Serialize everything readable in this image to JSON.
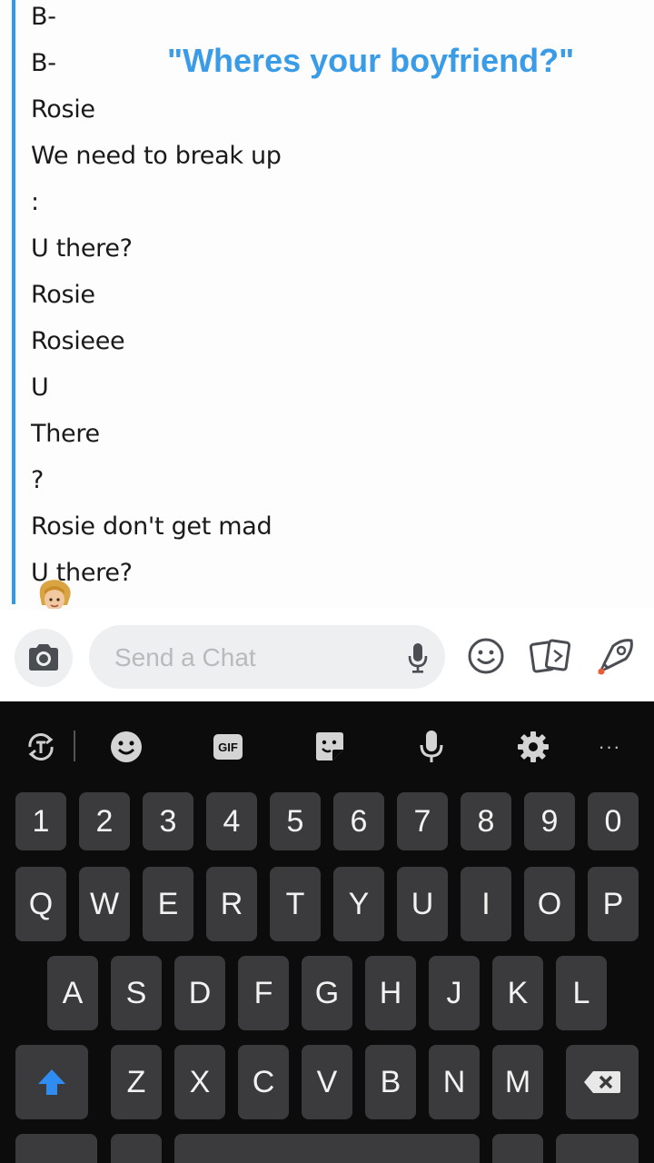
{
  "overlay_caption": "\"Wheres your boyfriend?\"",
  "messages": [
    {
      "text": "B-"
    },
    {
      "text": "B-"
    },
    {
      "text": "Rosie"
    },
    {
      "text": "We need to break up"
    },
    {
      "text": ":"
    },
    {
      "text": "U there?"
    },
    {
      "text": "Rosie"
    },
    {
      "text": "Rosieee"
    },
    {
      "text": "U"
    },
    {
      "text": "There"
    },
    {
      "text": "?"
    },
    {
      "text": " Rosie don't get mad"
    },
    {
      "text": "U there?"
    }
  ],
  "input": {
    "placeholder": "Send a Chat"
  },
  "keyboard": {
    "row_numbers": [
      "1",
      "2",
      "3",
      "4",
      "5",
      "6",
      "7",
      "8",
      "9",
      "0"
    ],
    "row_q": [
      "Q",
      "W",
      "E",
      "R",
      "T",
      "Y",
      "U",
      "I",
      "O",
      "P"
    ],
    "row_a": [
      "A",
      "S",
      "D",
      "F",
      "G",
      "H",
      "J",
      "K",
      "L"
    ],
    "row_z": [
      "Z",
      "X",
      "C",
      "V",
      "B",
      "N",
      "M"
    ],
    "gif_label": "GIF",
    "more_label": "···"
  },
  "colors": {
    "accent_bar": "#2f9be8",
    "overlay_text": "#3a9be6",
    "shift_arrow": "#2f8cf0"
  }
}
